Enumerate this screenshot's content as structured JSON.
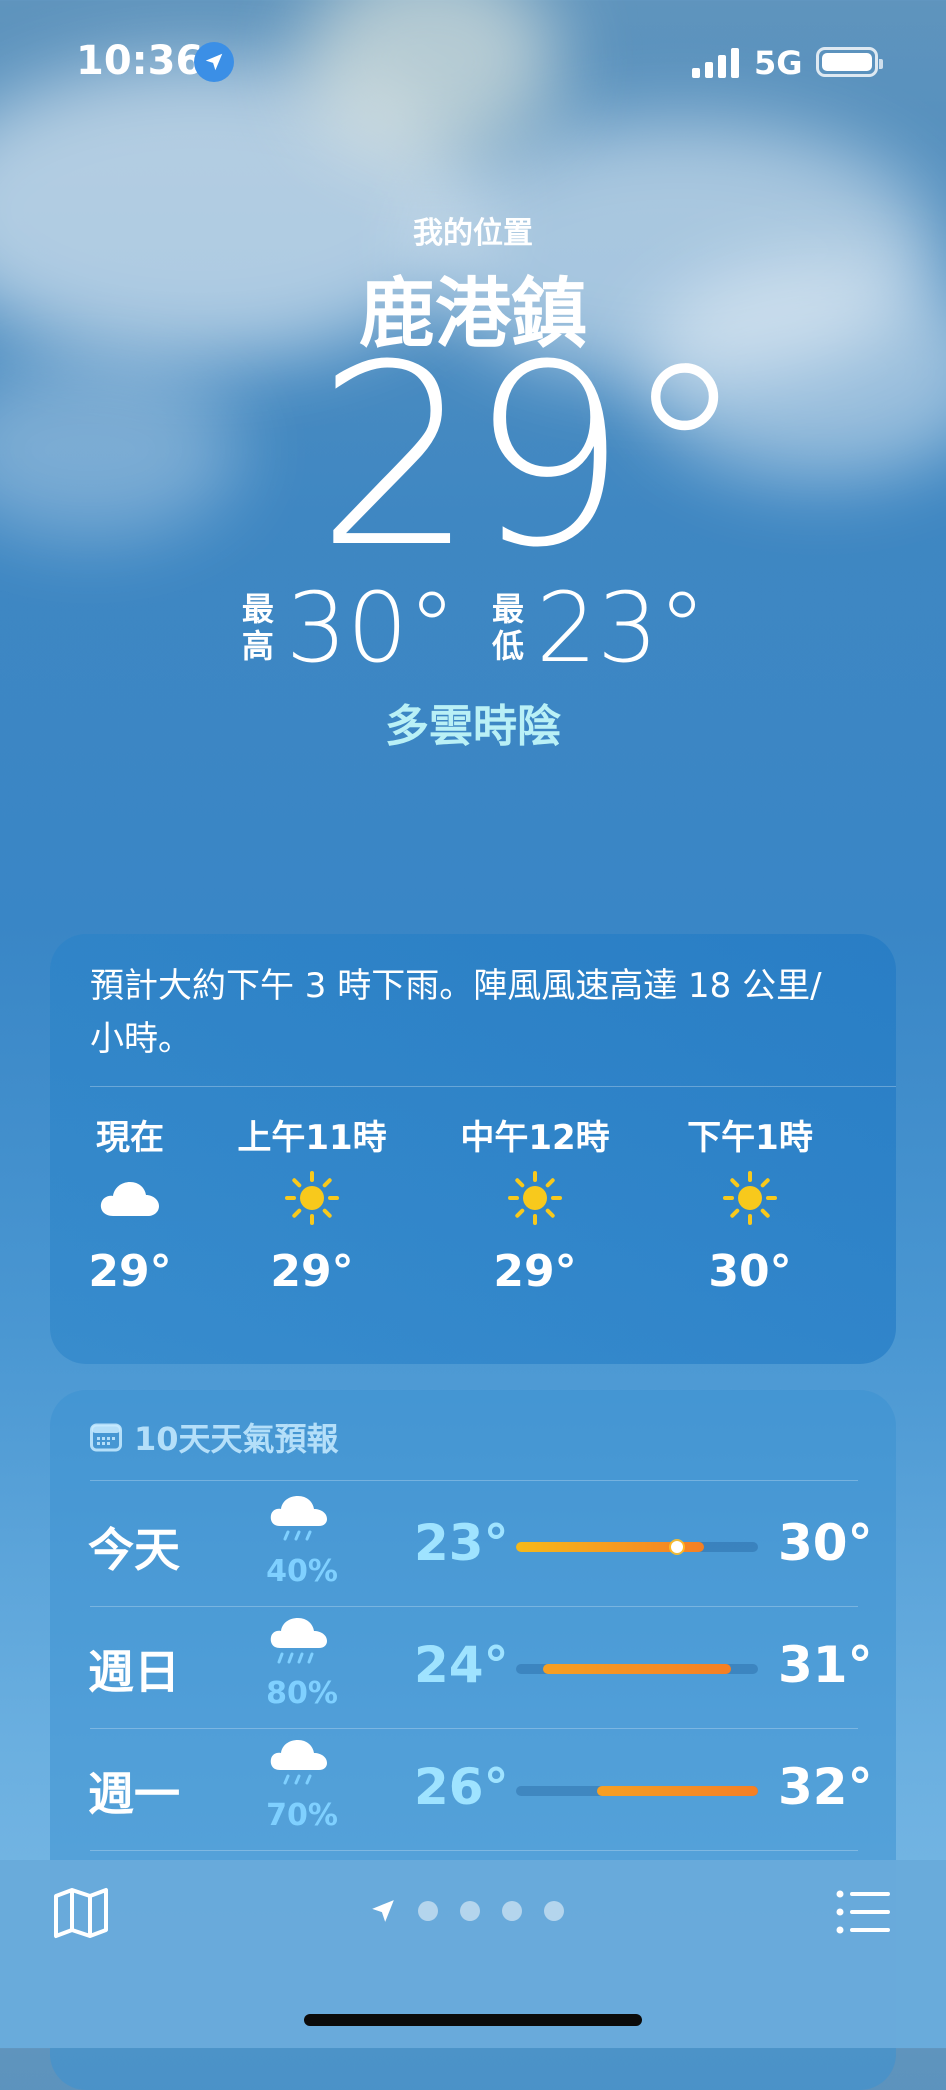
{
  "status_bar": {
    "time": "10:36",
    "network": "5G"
  },
  "location": {
    "label": "我的位置",
    "city": "鹿港鎮"
  },
  "current": {
    "temp": "29°",
    "high_label": "最高",
    "high": "30°",
    "low_label": "最低",
    "low": "23°",
    "condition": "多雲時陰"
  },
  "hourly": {
    "summary": "預計大約下午 3 時下雨。陣風風速高達 18 公里/小時。",
    "items": [
      {
        "label": "現在",
        "icon": "cloud-icon",
        "temp": "29°"
      },
      {
        "label": "上午11時",
        "icon": "sun-icon",
        "temp": "29°"
      },
      {
        "label": "中午12時",
        "icon": "sun-icon",
        "temp": "29°"
      },
      {
        "label": "下午1時",
        "icon": "sun-icon",
        "temp": "30°"
      }
    ]
  },
  "daily": {
    "header": "10天天氣預報",
    "range_min": 23,
    "range_max": 32,
    "current_temp": 29,
    "days": [
      {
        "name": "今天",
        "icon": "cloud-rain-icon",
        "precip": "40%",
        "low": "23°",
        "high": "30°",
        "low_val": 23,
        "high_val": 30,
        "show_current": true
      },
      {
        "name": "週日",
        "icon": "cloud-heavy-rain-icon",
        "precip": "80%",
        "low": "24°",
        "high": "31°",
        "low_val": 24,
        "high_val": 31,
        "show_current": false
      },
      {
        "name": "週一",
        "icon": "cloud-rain-icon",
        "precip": "70%",
        "low": "26°",
        "high": "32°",
        "low_val": 26,
        "high_val": 32,
        "show_current": false
      }
    ]
  },
  "pager": {
    "pages": 4,
    "active": 0
  },
  "colors": {
    "condition_text": "#b9f0f6",
    "sun": "#f8c91c",
    "bar_cool": "#f6b91a",
    "bar_warm": "#f57f24",
    "precip_text": "#7fd0ff"
  }
}
